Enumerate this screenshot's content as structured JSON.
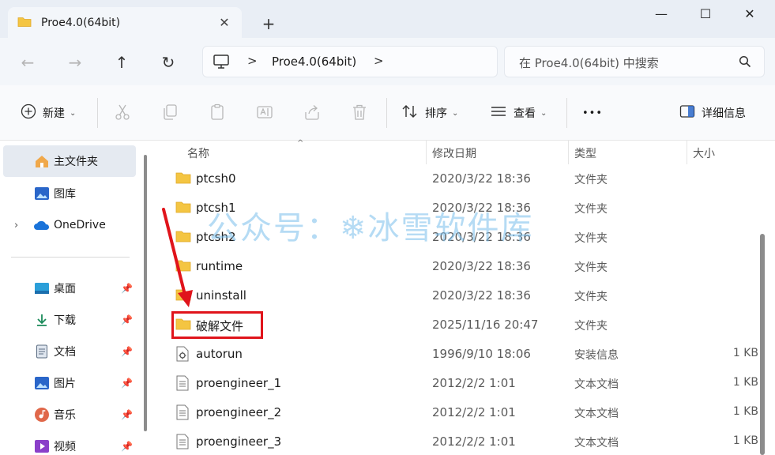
{
  "tab": {
    "title": "Proe4.0(64bit)",
    "close": "✕",
    "new_tab": "+"
  },
  "window": {
    "minimize": "—",
    "maximize": "☐",
    "close": "✕"
  },
  "nav": {
    "back": "←",
    "forward": "→",
    "up": "↑",
    "refresh": "↻"
  },
  "address": {
    "separator": ">",
    "crumb": "Proe4.0(64bit)"
  },
  "search": {
    "placeholder": "在 Proe4.0(64bit) 中搜索"
  },
  "toolbar": {
    "new_label": "新建",
    "sort_label": "排序",
    "view_label": "查看",
    "more_label": "•••",
    "details_label": "详细信息",
    "disabled_icons": [
      "cut-icon",
      "copy-icon",
      "paste-icon",
      "rename-icon",
      "share-icon",
      "delete-icon"
    ]
  },
  "sidebar": {
    "items": [
      {
        "label": "主文件夹",
        "icon": "home-icon",
        "active": true
      },
      {
        "label": "图库",
        "icon": "gallery-icon"
      },
      {
        "label": "OneDrive",
        "icon": "cloud-icon",
        "expandable": true
      },
      {
        "label": "桌面",
        "icon": "desktop-icon",
        "pinned": true
      },
      {
        "label": "下载",
        "icon": "download-icon",
        "pinned": true
      },
      {
        "label": "文档",
        "icon": "document-icon",
        "pinned": true
      },
      {
        "label": "图片",
        "icon": "picture-icon",
        "pinned": true
      },
      {
        "label": "音乐",
        "icon": "music-icon",
        "pinned": true
      },
      {
        "label": "视频",
        "icon": "video-icon",
        "pinned": true
      }
    ]
  },
  "columns": {
    "name": "名称",
    "modified": "修改日期",
    "type": "类型",
    "size": "大小"
  },
  "files": [
    {
      "name": "ptcsh0",
      "date": "2020/3/22 18:36",
      "type": "文件夹",
      "size": "",
      "icon": "folder"
    },
    {
      "name": "ptcsh1",
      "date": "2020/3/22 18:36",
      "type": "文件夹",
      "size": "",
      "icon": "folder"
    },
    {
      "name": "ptcsh2",
      "date": "2020/3/22 18:36",
      "type": "文件夹",
      "size": "",
      "icon": "folder"
    },
    {
      "name": "runtime",
      "date": "2020/3/22 18:36",
      "type": "文件夹",
      "size": "",
      "icon": "folder"
    },
    {
      "name": "uninstall",
      "date": "2020/3/22 18:36",
      "type": "文件夹",
      "size": "",
      "icon": "folder"
    },
    {
      "name": "破解文件",
      "date": "2025/11/16 20:47",
      "type": "文件夹",
      "size": "",
      "icon": "folder"
    },
    {
      "name": "autorun",
      "date": "1996/9/10 18:06",
      "type": "安装信息",
      "size": "1 KB",
      "icon": "setup"
    },
    {
      "name": "proengineer_1",
      "date": "2012/2/2 1:01",
      "type": "文本文档",
      "size": "1 KB",
      "icon": "text"
    },
    {
      "name": "proengineer_2",
      "date": "2012/2/2 1:01",
      "type": "文本文档",
      "size": "1 KB",
      "icon": "text"
    },
    {
      "name": "proengineer_3",
      "date": "2012/2/2 1:01",
      "type": "文本文档",
      "size": "1 KB",
      "icon": "text"
    }
  ],
  "watermark": "公众号：❄冰雪软件库",
  "colors": {
    "folder": "#f4c542",
    "highlight": "#e0141b",
    "accent": "#2a66c9"
  }
}
